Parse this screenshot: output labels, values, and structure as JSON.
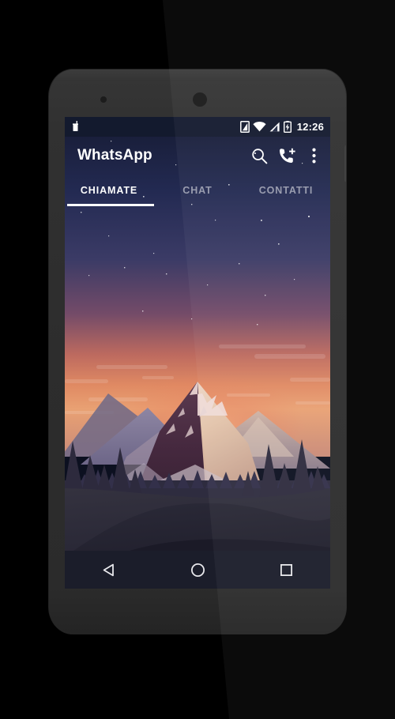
{
  "device": {
    "name": "android-phone",
    "body_color": "#2e2e2e",
    "screen_bg": "#0c1020"
  },
  "status_bar": {
    "background": "#131a2e",
    "clock": "12:26",
    "left_icons": [
      {
        "name": "notification-icon",
        "label": "notification"
      }
    ],
    "right_icons": [
      {
        "name": "sim-card-icon",
        "label": "no-sim"
      },
      {
        "name": "wifi-icon",
        "label": "wifi"
      },
      {
        "name": "cellular-signal-icon",
        "label": "signal"
      },
      {
        "name": "battery-charging-icon",
        "label": "battery charging"
      }
    ]
  },
  "app_bar": {
    "title": "WhatsApp",
    "actions": [
      {
        "name": "search-icon",
        "label": "Cerca"
      },
      {
        "name": "add-call-icon",
        "label": "Nuova chiamata"
      },
      {
        "name": "overflow-menu-icon",
        "label": "Altre opzioni"
      }
    ]
  },
  "tabs": {
    "active_index": 0,
    "indicator_color": "#ffffff",
    "items": [
      {
        "label": "CHIAMATE",
        "active": true
      },
      {
        "label": "CHAT",
        "active": false
      },
      {
        "label": "CONTATTI",
        "active": false
      }
    ]
  },
  "content": {
    "empty": true,
    "wallpaper": {
      "name": "mountain-sunset-wallpaper",
      "sky_top": "#222a4e",
      "sky_horizon": "#e8775a",
      "peak_dark": "#4a3045",
      "peak_light": "#e8cdbb",
      "foreground": "#2a2836"
    }
  },
  "nav_bar": {
    "background": "#1b1d2a",
    "buttons": [
      {
        "name": "nav-back-button",
        "label": "Indietro"
      },
      {
        "name": "nav-home-button",
        "label": "Home"
      },
      {
        "name": "nav-recents-button",
        "label": "Recenti"
      }
    ]
  }
}
